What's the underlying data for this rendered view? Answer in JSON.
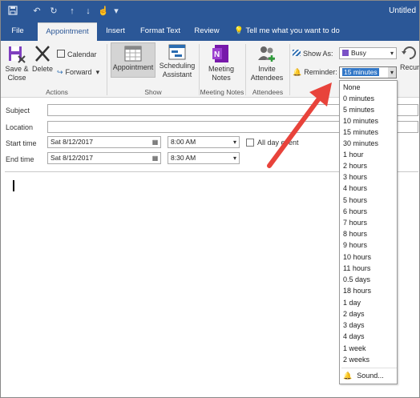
{
  "titlebar": {
    "title": "Untitled",
    "quick_access": [
      {
        "icon": "save-icon",
        "glyph": "💾"
      },
      {
        "icon": "undo-icon",
        "glyph": "↶"
      },
      {
        "icon": "redo-icon",
        "glyph": "↻"
      },
      {
        "icon": "up-arrow-icon",
        "glyph": "↑"
      },
      {
        "icon": "down-arrow-icon",
        "glyph": "↓"
      },
      {
        "icon": "touch-mode-icon",
        "glyph": "☝"
      },
      {
        "icon": "customize-icon",
        "glyph": "▾"
      }
    ]
  },
  "tabs": [
    {
      "label": "File"
    },
    {
      "label": "Appointment"
    },
    {
      "label": "Insert"
    },
    {
      "label": "Format Text"
    },
    {
      "label": "Review"
    },
    {
      "label": "Tell me what you want to do"
    }
  ],
  "ribbon": {
    "actions": {
      "save_close": "Save & Close",
      "delete": "Delete",
      "calendar": "Calendar",
      "forward": "Forward",
      "group": "Actions"
    },
    "show": {
      "appointment": "Appointment",
      "scheduling": "Scheduling Assistant",
      "group": "Show"
    },
    "meeting_notes": {
      "label": "Meeting Notes",
      "group": "Meeting Notes"
    },
    "attendees": {
      "invite": "Invite Attendees",
      "group": "Attendees"
    },
    "options": {
      "show_as_label": "Show As:",
      "show_as_value": "Busy",
      "reminder_label": "Reminder:",
      "reminder_value": "15 minutes",
      "recurrence": "Recurre"
    }
  },
  "form": {
    "subject_label": "Subject",
    "location_label": "Location",
    "start_label": "Start time",
    "end_label": "End time",
    "start_date": "Sat 8/12/2017",
    "start_time": "8:00 AM",
    "end_date": "Sat 8/12/2017",
    "end_time": "8:30 AM",
    "all_day": "All day event"
  },
  "reminder_options": [
    "None",
    "0 minutes",
    "5 minutes",
    "10 minutes",
    "15 minutes",
    "30 minutes",
    "1 hour",
    "2 hours",
    "3 hours",
    "4 hours",
    "5 hours",
    "6 hours",
    "7 hours",
    "8 hours",
    "9 hours",
    "10 hours",
    "11 hours",
    "0.5 days",
    "18 hours",
    "1 day",
    "2 days",
    "3 days",
    "4 days",
    "1 week",
    "2 weeks"
  ],
  "sound_label": "Sound...",
  "colors": {
    "title_blue": "#2b5797",
    "accent_red": "#e8433b"
  }
}
